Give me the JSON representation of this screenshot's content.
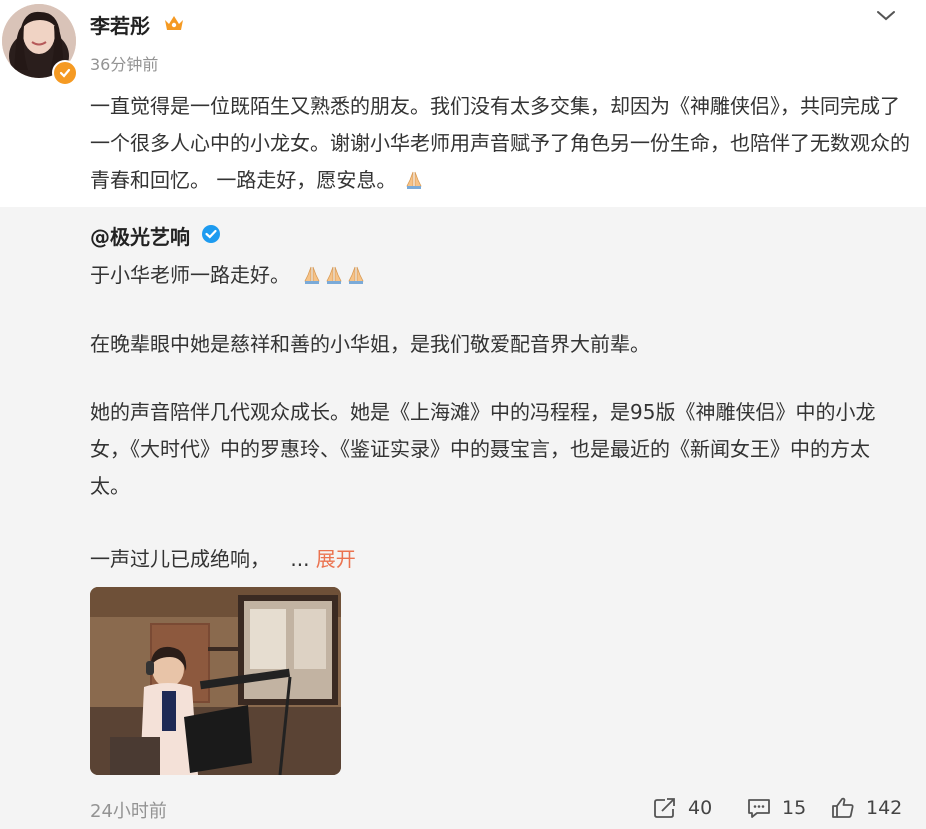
{
  "post": {
    "author": "李若彤",
    "time": "36分钟前",
    "text": "一直觉得是一位既陌生又熟悉的朋友。我们没有太多交集，却因为《神雕侠侣》，共同完成了一个很多人心中的小龙女。谢谢小华老师用声音赋予了角色另一份生命，也陪伴了无数观众的青春和回忆。 一路走好，愿安息。"
  },
  "repost": {
    "author": "@极光艺响",
    "line1": "于小华老师一路走好。",
    "line2": "在晚辈眼中她是慈祥和善的小华姐，是我们敬爱配音界大前辈。",
    "paragraph": "她的声音陪伴几代观众成长。她是《上海滩》中的冯程程，是95版《神雕侠侣》中的小龙女，《大时代》中的罗惠玲、《鉴证实录》中的聂宝言，也是最近的《新闻女王》中的方太太。",
    "truncated": "一声过儿已成绝响，",
    "ellipsis": "...",
    "expand": "展开",
    "time": "24小时前",
    "stats": {
      "reposts": "40",
      "comments": "15",
      "likes": "142"
    }
  },
  "icons": {
    "crown": "crown-icon",
    "verified": "verified-icon",
    "pray": "praying-hands-emoji",
    "share": "share-icon",
    "comment": "comment-icon",
    "like": "thumbs-up-icon",
    "more": "chevron-down-icon"
  },
  "colors": {
    "accent": "#eb7350",
    "verified": "#1d9bf0",
    "crown": "#f59a23",
    "meta": "#939393",
    "repost_bg": "#f4f4f4"
  }
}
